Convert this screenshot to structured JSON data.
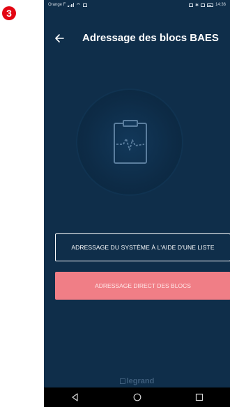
{
  "step": "3",
  "status_bar": {
    "carrier": "Orange F",
    "time": "14:36"
  },
  "header": {
    "title": "Adressage des blocs BAES",
    "back_icon": "back-arrow-icon"
  },
  "illustration": {
    "icon": "clipboard-pulse-icon"
  },
  "buttons": {
    "list_label": "ADRESSAGE DU SYSTÈME À L'AIDE D'UNE LISTE",
    "direct_label": "ADRESSAGE DIRECT DES BLOCS"
  },
  "brand": {
    "name": "legrand"
  },
  "nav": {
    "back": "triangle-back-icon",
    "home": "circle-home-icon",
    "recents": "square-recents-icon"
  },
  "colors": {
    "background": "#0f2e4a",
    "primary_button": "#f07e86",
    "badge": "#e30613"
  }
}
